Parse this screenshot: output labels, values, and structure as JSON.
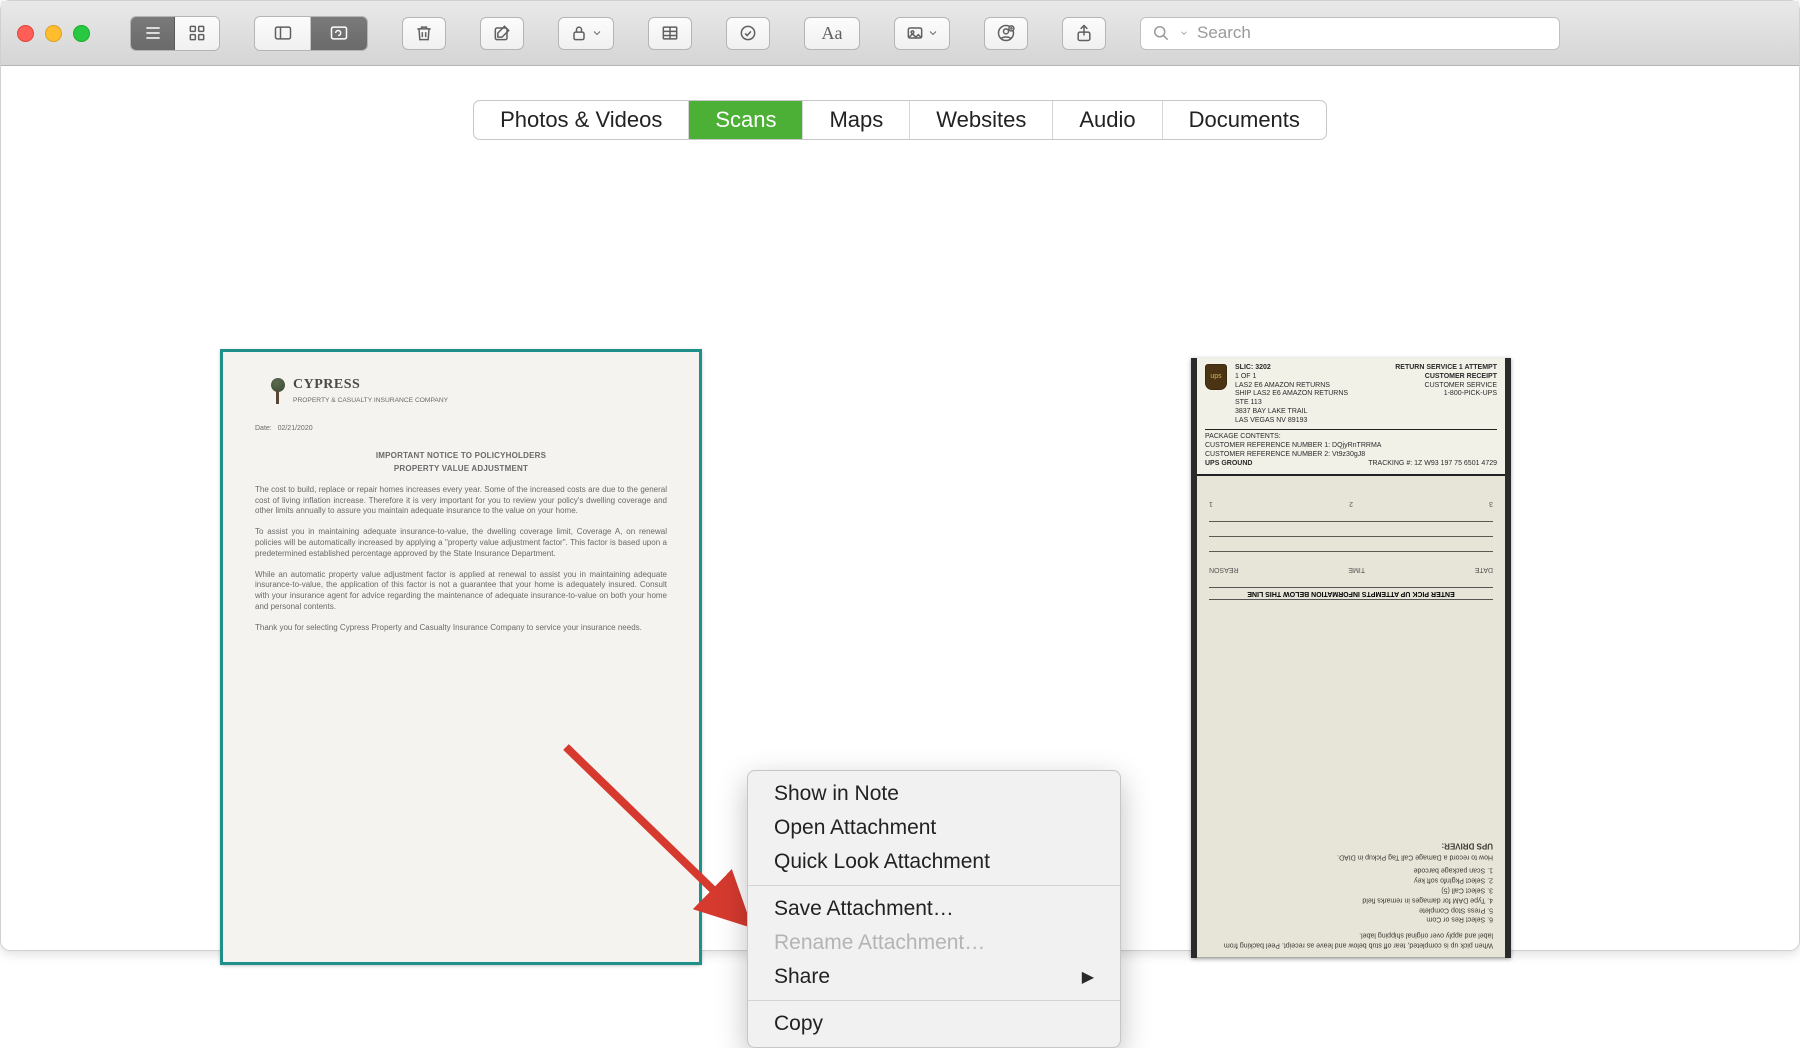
{
  "search": {
    "placeholder": "Search"
  },
  "tabs": {
    "items": [
      {
        "label": "Photos & Videos"
      },
      {
        "label": "Scans"
      },
      {
        "label": "Maps"
      },
      {
        "label": "Websites"
      },
      {
        "label": "Audio"
      },
      {
        "label": "Documents"
      }
    ],
    "active_index": 1
  },
  "context_menu": {
    "show_in_note": "Show in Note",
    "open_attachment": "Open Attachment",
    "quick_look": "Quick Look Attachment",
    "save_attachment": "Save Attachment…",
    "rename_attachment": "Rename Attachment…",
    "share": "Share",
    "copy": "Copy"
  },
  "doc1": {
    "brand": "CYPRESS",
    "brand_sub": "PROPERTY & CASUALTY INSURANCE COMPANY",
    "date_label": "Date:",
    "date_value": "02/21/2020",
    "title1": "IMPORTANT NOTICE TO POLICYHOLDERS",
    "title2": "PROPERTY VALUE ADJUSTMENT",
    "p1": "The cost to build, replace or repair homes increases every year. Some of the increased costs are due to the general cost of living inflation increase. Therefore it is very important for you to review your policy's dwelling coverage and other limits annually to assure you maintain adequate insurance to the value on your home.",
    "p2": "To assist you in maintaining adequate insurance-to-value, the dwelling coverage limit, Coverage A, on renewal policies will be automatically increased by applying a \"property value adjustment factor\". This factor is based upon a predetermined established percentage approved by the State Insurance Department.",
    "p3": "While an automatic property value adjustment factor is applied at renewal to assist you in maintaining adequate insurance-to-value, the application of this factor is not a guarantee that your home is adequately insured. Consult with your insurance agent for advice regarding the maintenance of adequate insurance-to-value on both your home and personal contents.",
    "p4": "Thank you for selecting Cypress Property and Casualty Insurance Company to service your insurance needs."
  },
  "doc2": {
    "ups": "ups",
    "slic": "SLIC: 3202",
    "service": "RETURN SERVICE 1 ATTEMPT",
    "receipt": "CUSTOMER RECEIPT",
    "count": "1 OF 1",
    "addr1": "LAS2 E6 AMAZON RETURNS",
    "addr2": "SHIP LAS2 E6 AMAZON RETURNS",
    "addr3": "STE 113",
    "addr4": "3837 BAY LAKE TRAIL",
    "addr5": "LAS VEGAS NV 89193",
    "cs1": "CUSTOMER SERVICE",
    "cs2": "1-800-PICK-UPS",
    "pkg": "PACKAGE CONTENTS:",
    "ref1": "CUSTOMER REFERENCE NUMBER 1: DQjyRnTRRMA",
    "ref2": "CUSTOMER REFERENCE NUMBER 2: Vt9z30gJ8",
    "ground": "UPS GROUND",
    "tracking": "TRACKING #: 1Z W93 197 75 6501 4729",
    "driver": "UPS DRIVER:",
    "howto": "How to record a Damage Call Tag Pickup in DIAD.",
    "s1": "1. Scan package barcode",
    "s2": "2. Select PkgInfo soft key",
    "s3": "3. Select Call (5)",
    "s4": "4. Type DAM for damages in remarks field",
    "s5": "5. Press Stop Complete",
    "s6": "6. Select Res or Com",
    "note": "When pick up is completed, tear off stub below and leave as receipt. Peel backing from label and apply over original shipping label.",
    "enter": "ENTER PICK UP ATTEMPTS INFORMATION BELOW THIS LINE",
    "c1": "DATE",
    "c2": "TIME",
    "c3": "REASON"
  }
}
